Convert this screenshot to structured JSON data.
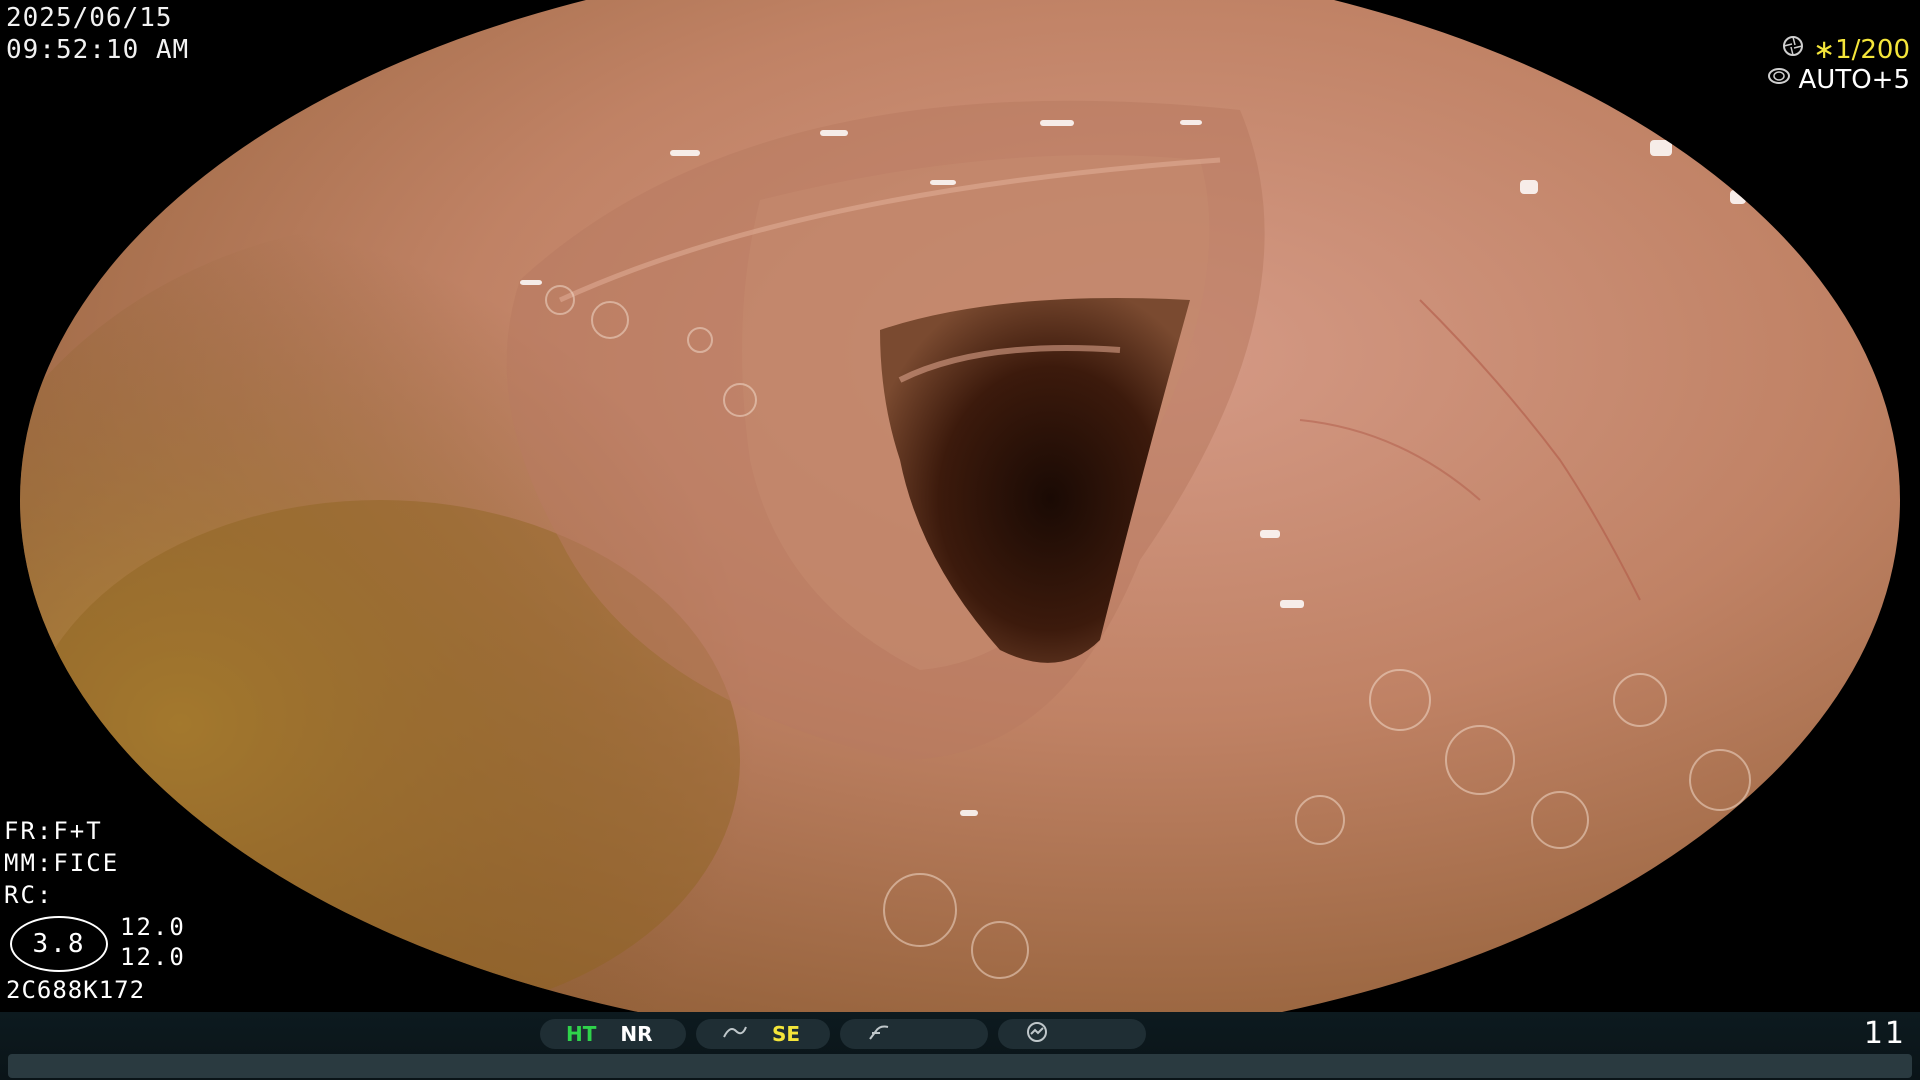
{
  "overlay": {
    "date": "2025/06/15",
    "time": "09:52:10   AM"
  },
  "top_right": {
    "shutter_icon": "shutter-icon",
    "shutter_value": "∗1/200",
    "iris_icon": "iris-icon",
    "iris_value": "AUTO+5"
  },
  "left_info": {
    "fr": "FR:F+T",
    "mm": "MM:FICE",
    "rc": "RC:",
    "oval_value": "3.8",
    "value_a": "12.0",
    "value_b": "12.0",
    "serial": "2C688K172"
  },
  "status_bar": {
    "ht": "HT",
    "nr": "NR",
    "se_icon": "curve-icon",
    "se": "SE",
    "slash_icon": "slash-curve-icon",
    "gauge_icon": "gauge-icon",
    "frame_number": "11"
  },
  "colors": {
    "ht": "#2fd34b",
    "se": "#f4e53a",
    "shutter": "#f4e53a"
  }
}
